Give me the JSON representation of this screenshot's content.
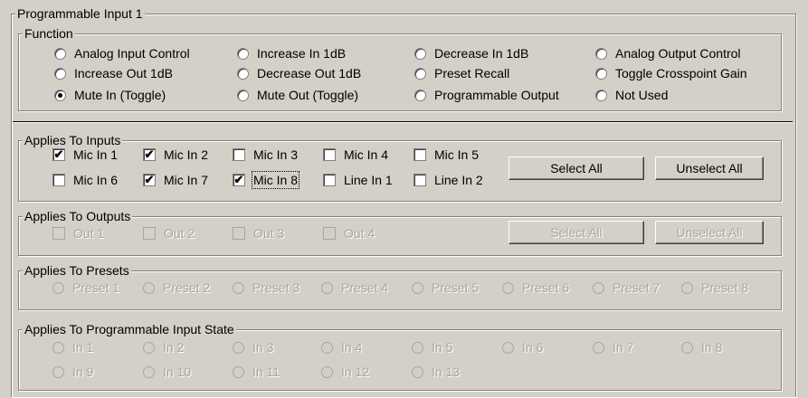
{
  "group_title": "Programmable Input 1",
  "function": {
    "title": "Function",
    "options": [
      {
        "label": "Analog Input Control",
        "checked": false
      },
      {
        "label": "Increase In 1dB",
        "checked": false
      },
      {
        "label": "Decrease In 1dB",
        "checked": false
      },
      {
        "label": "Analog Output Control",
        "checked": false
      },
      {
        "label": "Increase Out 1dB",
        "checked": false
      },
      {
        "label": "Decrease Out 1dB",
        "checked": false
      },
      {
        "label": "Preset Recall",
        "checked": false
      },
      {
        "label": "Toggle Crosspoint Gain",
        "checked": false
      },
      {
        "label": "Mute In (Toggle)",
        "checked": true
      },
      {
        "label": "Mute Out (Toggle)",
        "checked": false
      },
      {
        "label": "Programmable Output",
        "checked": false
      },
      {
        "label": "Not Used",
        "checked": false
      }
    ]
  },
  "inputs": {
    "title": "Applies To Inputs",
    "items": [
      {
        "label": "Mic In 1",
        "checked": true
      },
      {
        "label": "Mic In 2",
        "checked": true
      },
      {
        "label": "Mic In 3",
        "checked": false
      },
      {
        "label": "Mic In 4",
        "checked": false
      },
      {
        "label": "Mic In 5",
        "checked": false
      },
      {
        "label": "Mic In 6",
        "checked": false
      },
      {
        "label": "Mic In 7",
        "checked": true
      },
      {
        "label": "Mic In 8",
        "checked": true
      },
      {
        "label": "Line In 1",
        "checked": false
      },
      {
        "label": "Line In 2",
        "checked": false
      }
    ],
    "select_all": "Select All",
    "unselect_all": "Unselect All"
  },
  "outputs": {
    "title": "Applies To Outputs",
    "items": [
      {
        "label": "Out 1",
        "checked": false
      },
      {
        "label": "Out 2",
        "checked": false
      },
      {
        "label": "Out 3",
        "checked": false
      },
      {
        "label": "Out 4",
        "checked": false
      }
    ],
    "select_all": "Select All",
    "unselect_all": "Unselect All"
  },
  "presets": {
    "title": "Applies To Presets",
    "items": [
      "Preset 1",
      "Preset 2",
      "Preset 3",
      "Preset 4",
      "Preset 5",
      "Preset 6",
      "Preset 7",
      "Preset 8"
    ]
  },
  "states": {
    "title": "Applies To Programmable Input State",
    "items": [
      "In 1",
      "In 2",
      "In 3",
      "In 4",
      "In 5",
      "In 6",
      "In 7",
      "In 8",
      "In 9",
      "In 10",
      "In 11",
      "In 12",
      "In 13"
    ]
  }
}
